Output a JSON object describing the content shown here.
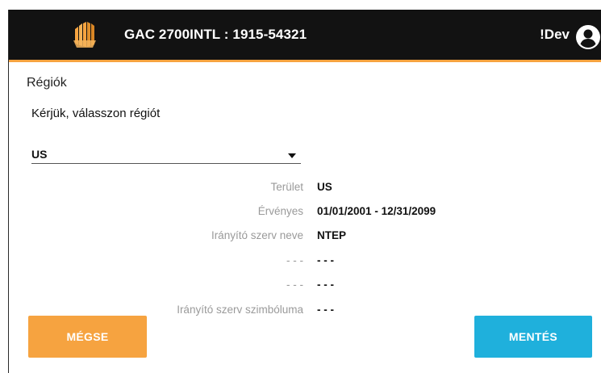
{
  "header": {
    "device_title": "GAC 2700INTL : 1915-54321",
    "user_name": "!Dev",
    "logo_icon": "stacked-bars-logo",
    "user_icon": "account-circle-icon",
    "accent_color": "#f6a340"
  },
  "page": {
    "section_title": "Régiók",
    "prompt": "Kérjük, válasszon régiót"
  },
  "region_select": {
    "value": "US"
  },
  "details": [
    {
      "label": "Terület",
      "value": "US"
    },
    {
      "label": "Érvényes",
      "value": "01/01/2001 - 12/31/2099"
    },
    {
      "label": "Irányító szerv neve",
      "value": "NTEP"
    },
    {
      "label": "- - -",
      "value": "- - -"
    },
    {
      "label": "- - -",
      "value": "- - -"
    },
    {
      "label": "Irányító szerv szimbóluma",
      "value": "- - -"
    }
  ],
  "actions": {
    "cancel_label": "MÉGSE",
    "save_label": "MENTÉS",
    "cancel_color": "#f6a340",
    "save_color": "#1fb0dc"
  }
}
